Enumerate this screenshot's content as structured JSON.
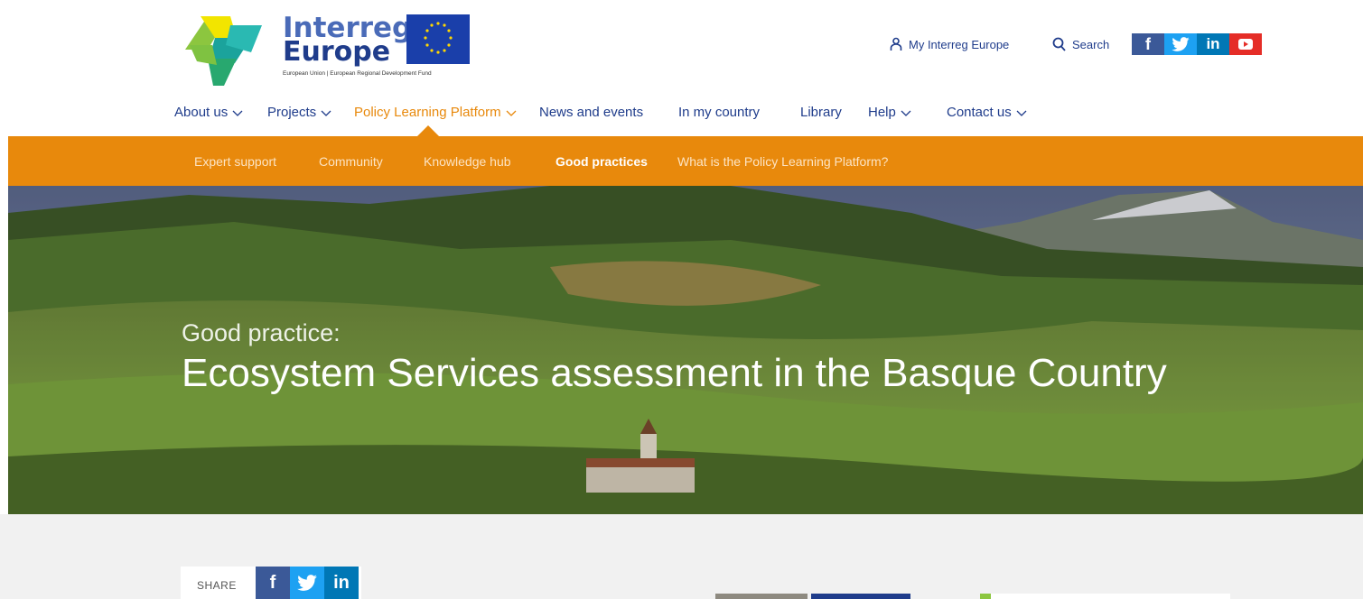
{
  "logo": {
    "word1": "Interreg",
    "word2": "Europe",
    "tagline": "European Union | European Regional Development Fund"
  },
  "utility": {
    "my_account": "My Interreg Europe",
    "search": "Search"
  },
  "nav": {
    "items": [
      {
        "label": "About us",
        "dropdown": true
      },
      {
        "label": "Projects",
        "dropdown": true
      },
      {
        "label": "Policy Learning Platform",
        "dropdown": true,
        "active": true
      },
      {
        "label": "News and events",
        "dropdown": false
      },
      {
        "label": "In my country",
        "dropdown": false
      },
      {
        "label": "Library",
        "dropdown": false
      },
      {
        "label": "Help",
        "dropdown": true
      },
      {
        "label": "Contact us",
        "dropdown": true
      }
    ]
  },
  "subnav": {
    "items": [
      {
        "label": "Expert support"
      },
      {
        "label": "Community"
      },
      {
        "label": "Knowledge hub"
      },
      {
        "label": "Good practices",
        "active": true
      },
      {
        "label": "What is the Policy Learning Platform?"
      }
    ]
  },
  "hero": {
    "kicker": "Good practice:",
    "title": "Ecosystem Services assessment in the Basque Country"
  },
  "share": {
    "label": "SHARE"
  },
  "colors": {
    "brand_blue": "#1f3c8b",
    "accent_orange": "#e8890c",
    "facebook": "#3b5998",
    "twitter": "#1da1f2",
    "linkedin": "#0077b5",
    "youtube": "#e52d27"
  },
  "icons": {
    "social_top": [
      "facebook-icon",
      "twitter-icon",
      "linkedin-icon",
      "youtube-icon"
    ],
    "share": [
      "facebook-icon",
      "twitter-icon",
      "linkedin-icon"
    ]
  }
}
